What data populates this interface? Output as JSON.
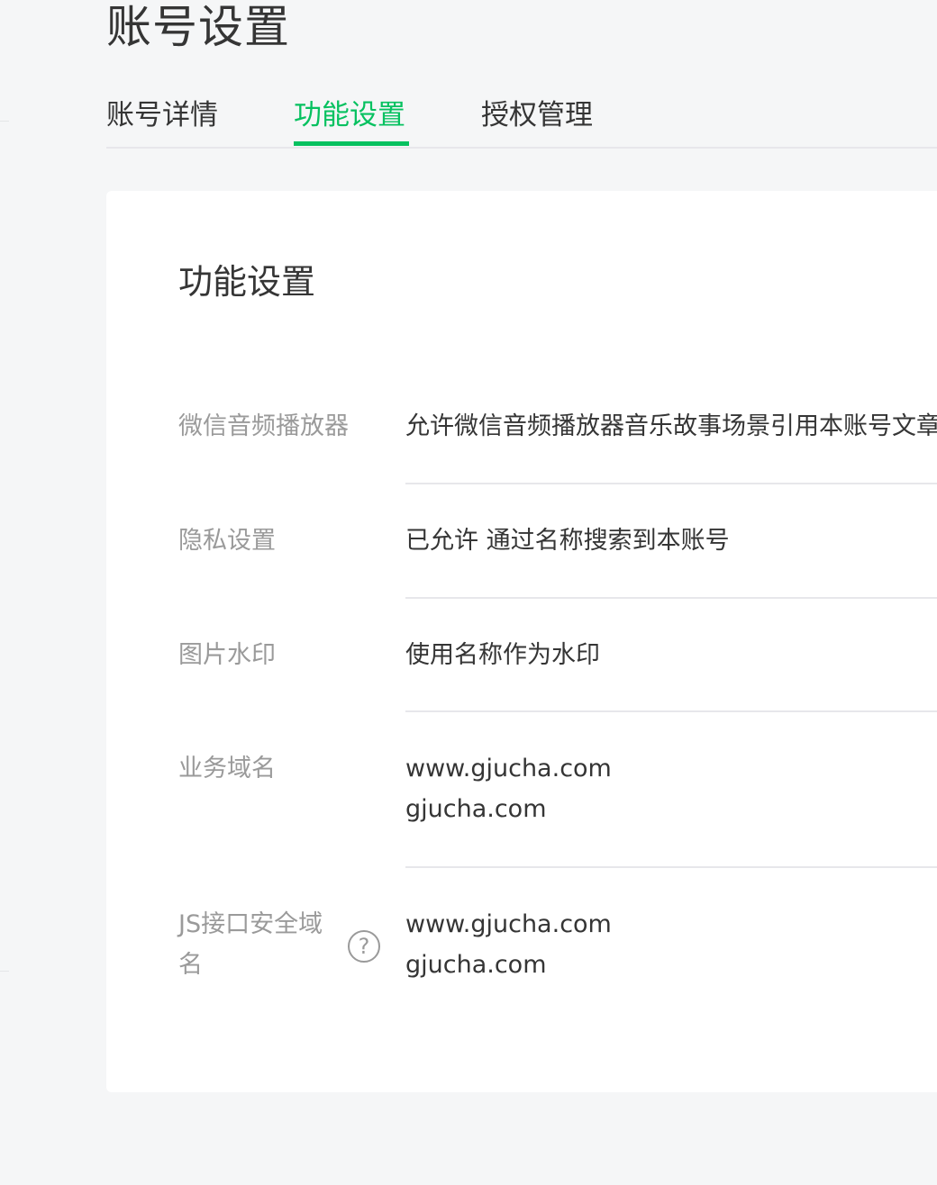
{
  "page": {
    "title": "账号设置"
  },
  "tabs": [
    {
      "label": "账号详情",
      "active": false
    },
    {
      "label": "功能设置",
      "active": true
    },
    {
      "label": "授权管理",
      "active": false
    }
  ],
  "colors": {
    "accent": "#07c160",
    "text": "#353535",
    "muted": "#9a9a9a",
    "background": "#f5f6f7",
    "divider": "#e7e7eb"
  },
  "card": {
    "title": "功能设置",
    "rows": [
      {
        "label": "微信音频播放器",
        "value": "允许微信音频播放器音乐故事场景引用本账号文章"
      },
      {
        "label": "隐私设置",
        "value": "已允许 通过名称搜索到本账号"
      },
      {
        "label": "图片水印",
        "value": "使用名称作为水印"
      },
      {
        "label": "业务域名",
        "values": [
          "www.gjucha.com",
          "gjucha.com"
        ]
      },
      {
        "label_line1": "JS接口安全域",
        "label_line2": "名",
        "help_icon": "question-circle-icon",
        "help_glyph": "?",
        "values": [
          "www.gjucha.com",
          "gjucha.com"
        ]
      }
    ]
  }
}
